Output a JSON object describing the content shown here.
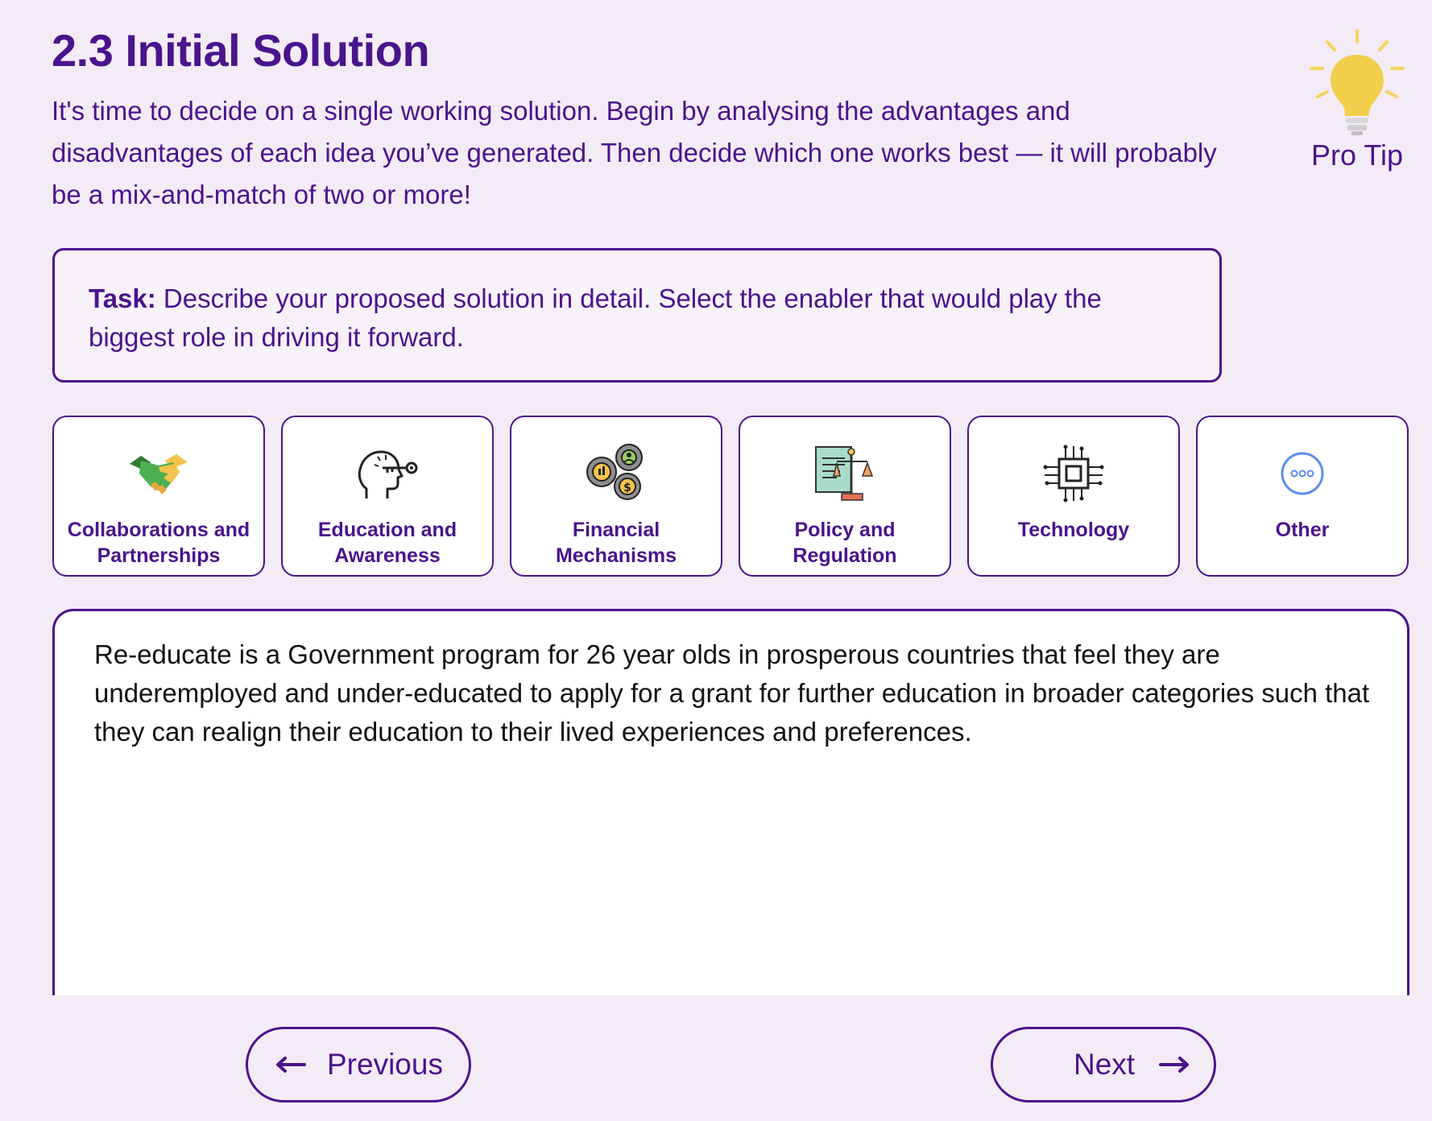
{
  "header": {
    "title": "2.3 Initial Solution",
    "intro": "It's time to decide on a single working solution. Begin by analysing the advantages and disadvantages of each idea you’ve generated. Then decide which one works best — it will probably be a mix-and-match of two or more!"
  },
  "pro_tip": {
    "label": "Pro Tip",
    "icon": "lightbulb-icon"
  },
  "task": {
    "key": "Task:",
    "text": " Describe your proposed solution in detail. Select the enabler that would play the biggest role in driving it forward."
  },
  "enablers": [
    {
      "line1": "Collaborations and",
      "line2": "Partnerships",
      "icon": "handshake-icon"
    },
    {
      "line1": "Education and",
      "line2": "Awareness",
      "icon": "head-key-icon"
    },
    {
      "line1": "Financial",
      "line2": "Mechanisms",
      "icon": "gears-money-icon"
    },
    {
      "line1": "Policy and",
      "line2": "Regulation",
      "icon": "scales-document-icon"
    },
    {
      "line1": "Technology",
      "line2": "",
      "icon": "chip-icon"
    },
    {
      "line1": "Other",
      "line2": "",
      "icon": "more-dots-icon"
    }
  ],
  "solution": {
    "text": "Re-educate is a Government program for 26 year olds in prosperous countries that feel they are underemployed and under-educated to apply for a grant for further education in broader categories such that they can realign their education to their lived experiences and preferences."
  },
  "nav": {
    "previous_label": "Previous",
    "next_label": "Next"
  },
  "colors": {
    "primary": "#4a148c",
    "background": "#f3ecf7",
    "bulb": "#f2cf4a"
  }
}
